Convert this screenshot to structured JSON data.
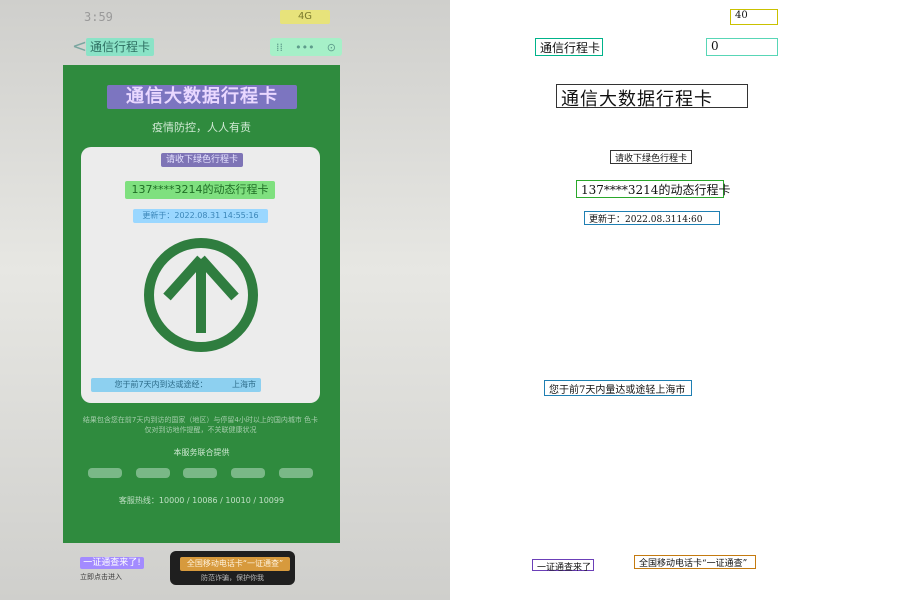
{
  "left_screen": {
    "status": {
      "time": "3:59",
      "network": "4G"
    },
    "nav": {
      "back": "<",
      "title": "通信行程卡",
      "actions": [
        "⁞⁞",
        "•••",
        "⊙"
      ]
    },
    "card": {
      "title": "通信大数据行程卡",
      "subtitle": "疫情防控，人人有责",
      "top_label": "请收下绿色行程卡",
      "phone_line": "137****3214的动态行程卡",
      "updated": "更新于：2022.08.31 14:55:16",
      "visited_label": "您于前7天内到达或途经：",
      "visited_city": "上海市",
      "description": "结果包含您在前7天内到访的国家（地区）与停留4小时以上的国内城市 色卡仅对到访地作提醒，不关联健康状况",
      "provider": "本服务联合提供",
      "hotline": "客服热线：10000 / 10086 / 10010 / 10099"
    },
    "bottom_left": {
      "line1": "一证通查来了!",
      "line2": "立即点击进入"
    },
    "bottom_right": {
      "line1": "全国移动电话卡“一证通查”",
      "line2": "防范诈骗，保护你我"
    }
  },
  "annotations": [
    {
      "label": "40",
      "color": "#c9c100"
    },
    {
      "label": "通信行程卡",
      "color": "#00b38a"
    },
    {
      "label": "0",
      "color": "#58d6b6"
    },
    {
      "label": "通信大数据行程卡",
      "color": "#333333"
    },
    {
      "label": "请收下绿色行程卡",
      "color": "#333333"
    },
    {
      "label": "137****3214的动态行程卡",
      "color": "#2aa82a"
    },
    {
      "label": "更新于：2022.08.3114:60",
      "color": "#1f7fb3"
    },
    {
      "label": "您于前7天内量达或途轻上海市",
      "color": "#1f7fb3"
    },
    {
      "label": "一证通查来了",
      "color": "#6b3fb8"
    },
    {
      "label": "全国移动电话卡“一证通查”",
      "color": "#c47a10"
    }
  ]
}
